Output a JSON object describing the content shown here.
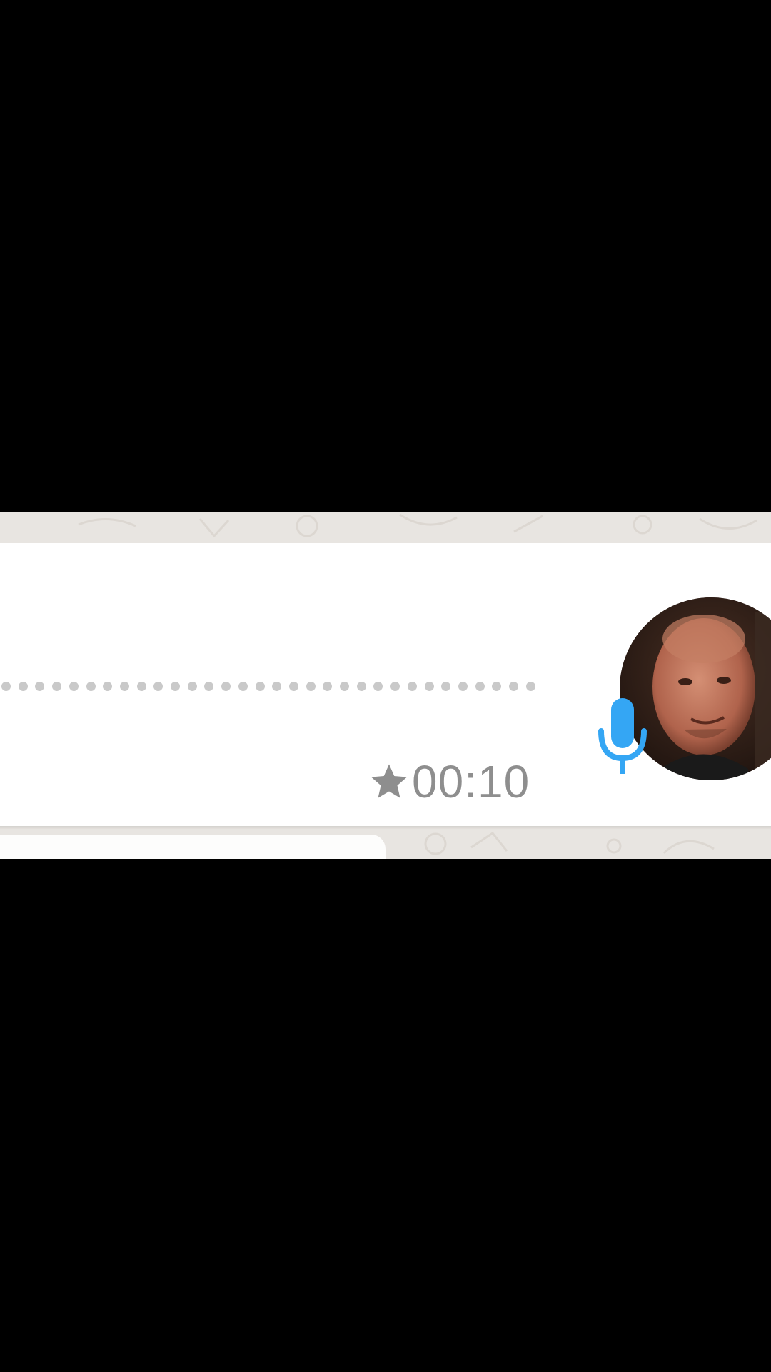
{
  "voice_message": {
    "duration": "00:10",
    "starred": true,
    "star_icon": "star-icon",
    "mic_icon": "microphone-icon",
    "mic_color": "#34a6f4",
    "text_color": "#8e8e8e",
    "waveform_dot_color": "#c9c9c9"
  },
  "avatar": {
    "icon": "contact-avatar"
  },
  "colors": {
    "background": "#000000",
    "wallpaper": "#e8e5e1",
    "bubble": "#ffffff"
  }
}
